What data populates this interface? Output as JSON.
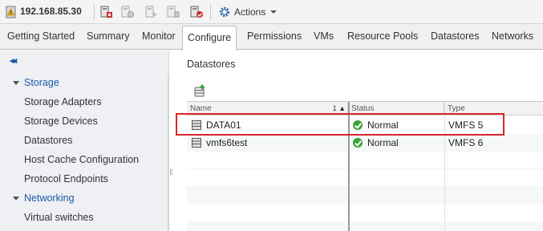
{
  "toolbar": {
    "host": "192.168.85.30",
    "actions_label": "Actions",
    "icons": [
      "host-icon",
      "add-host-icon",
      "enter-maintenance-icon",
      "exit-maintenance-icon",
      "refresh-host-icon",
      "actions-gear-icon"
    ]
  },
  "tabs": [
    {
      "label": "Getting Started"
    },
    {
      "label": "Summary"
    },
    {
      "label": "Monitor"
    },
    {
      "label": "Configure",
      "active": true
    },
    {
      "label": "Permissions"
    },
    {
      "label": "VMs"
    },
    {
      "label": "Resource Pools"
    },
    {
      "label": "Datastores"
    },
    {
      "label": "Networks"
    }
  ],
  "nav": {
    "collapse_glyph": "◂◂",
    "items": [
      {
        "label": "Storage",
        "group": true
      },
      {
        "label": "Storage Adapters"
      },
      {
        "label": "Storage Devices"
      },
      {
        "label": "Datastores"
      },
      {
        "label": "Host Cache Configuration"
      },
      {
        "label": "Protocol Endpoints"
      },
      {
        "label": "Networking",
        "group": true
      },
      {
        "label": "Virtual switches"
      }
    ]
  },
  "main": {
    "title": "Datastores",
    "columns": {
      "name": "Name",
      "sort_order": "1",
      "status": "Status",
      "type": "Type"
    },
    "rows": [
      {
        "name": "DATA01",
        "status": "Normal",
        "type": "VMFS 5"
      },
      {
        "name": "vmfs6test",
        "status": "Normal",
        "type": "VMFS 6"
      }
    ]
  },
  "colors": {
    "accent_blue": "#1a5ca8",
    "highlight_red": "#d9262b",
    "status_green": "#3aa33a"
  }
}
